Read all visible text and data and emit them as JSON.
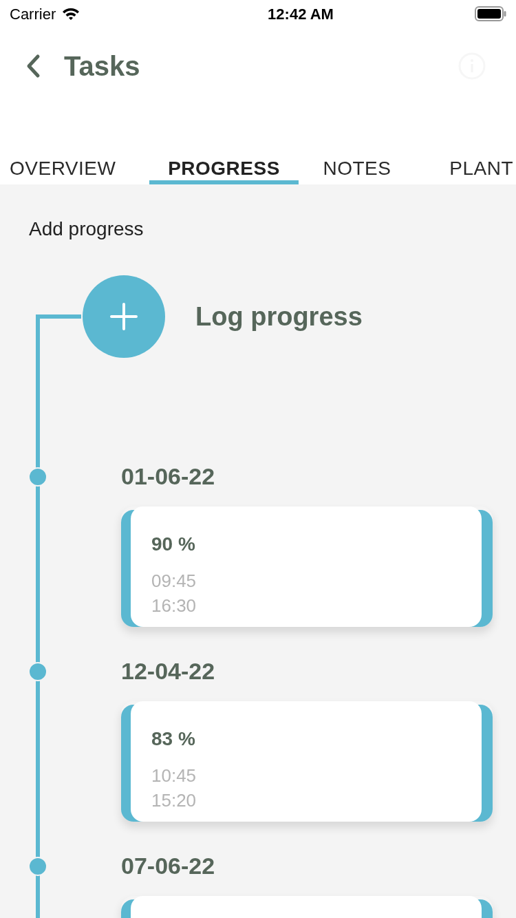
{
  "status_bar": {
    "carrier": "Carrier",
    "time": "12:42 AM"
  },
  "nav": {
    "title": "Tasks"
  },
  "tabs": [
    {
      "label": "OVERVIEW",
      "selected": false
    },
    {
      "label": "PROGRESS",
      "selected": true
    },
    {
      "label": "NOTES",
      "selected": false
    },
    {
      "label": "PLANT",
      "selected": false
    }
  ],
  "section_title": "Add progress",
  "log_button": {
    "label": "Log progress"
  },
  "entries": [
    {
      "date": "01-06-22",
      "percent": "90 %",
      "start": "09:45",
      "end": "16:30"
    },
    {
      "date": "12-04-22",
      "percent": "83 %",
      "start": "10:45",
      "end": "15:20"
    },
    {
      "date": "07-06-22"
    }
  ]
}
